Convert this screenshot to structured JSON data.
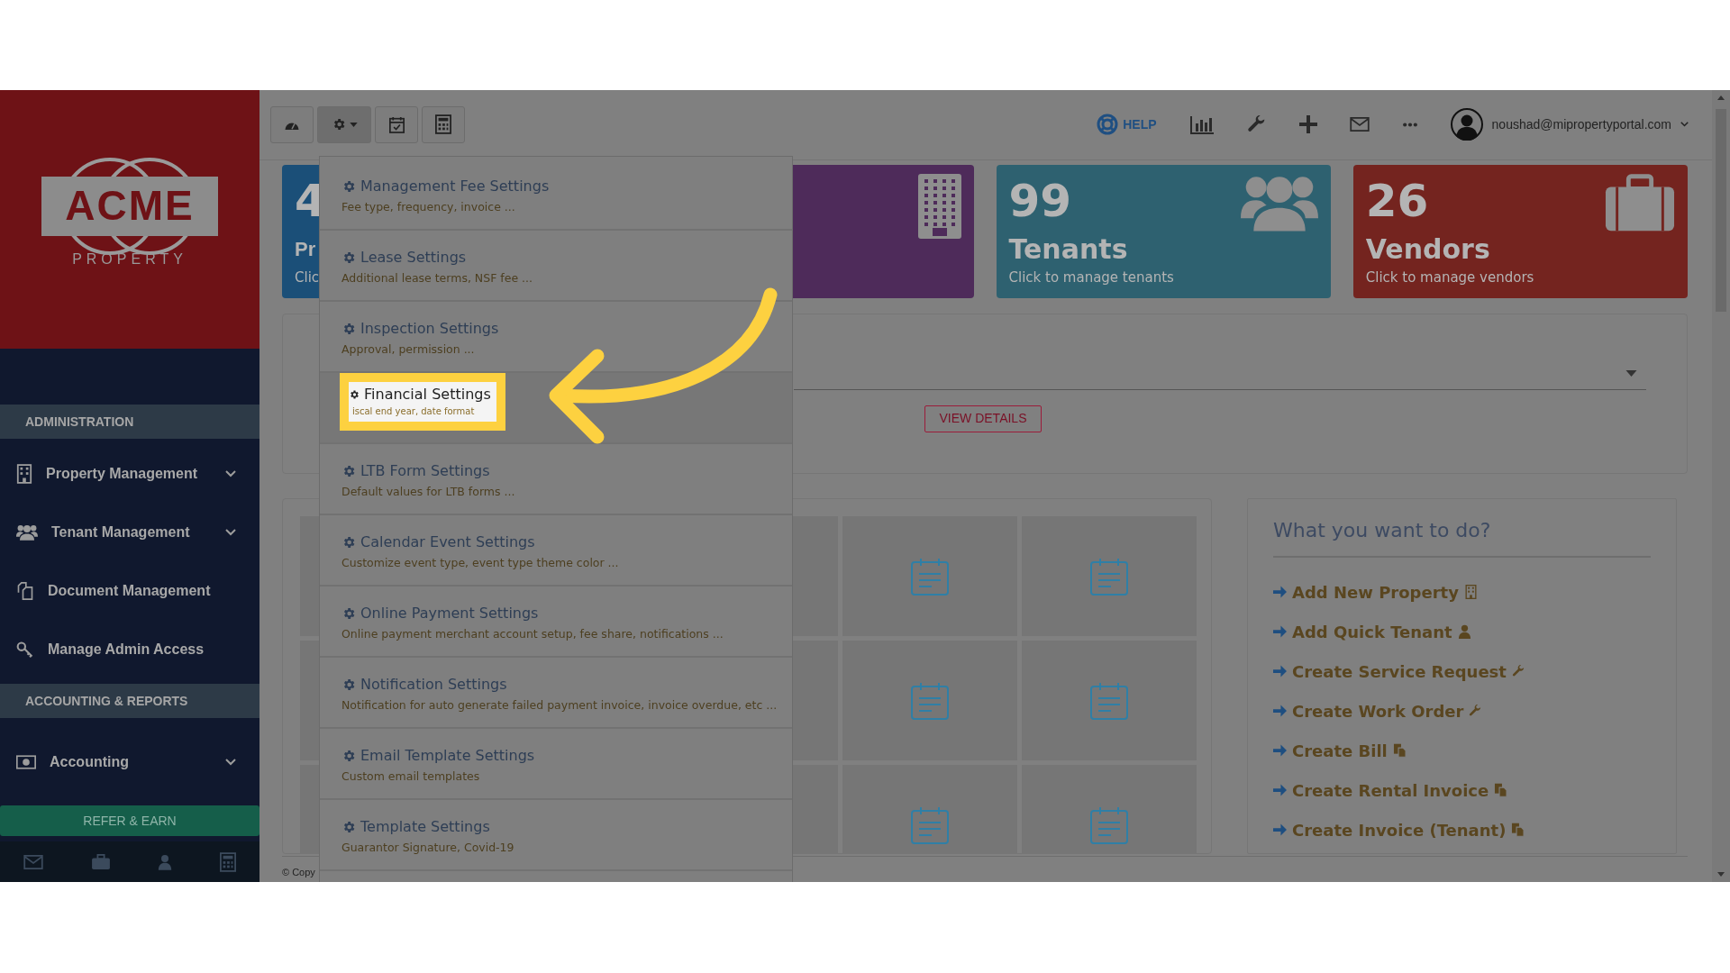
{
  "sidebar": {
    "logo": {
      "word": "ACME",
      "tagline": "PROPERTY"
    },
    "sections": [
      {
        "heading": "ADMINISTRATION",
        "items": [
          {
            "label": "Property Management",
            "expandable": true
          },
          {
            "label": "Tenant Management",
            "expandable": true
          },
          {
            "label": "Document Management",
            "expandable": false
          },
          {
            "label": "Manage Admin Access",
            "expandable": false
          }
        ]
      },
      {
        "heading": "ACCOUNTING & REPORTS",
        "items": [
          {
            "label": "Accounting",
            "expandable": true
          }
        ]
      }
    ],
    "refer_button": "REFER & EARN"
  },
  "toolbar": [
    {
      "selected": false
    },
    {
      "selected": true
    },
    {
      "selected": false
    },
    {
      "selected": false
    }
  ],
  "topbar": {
    "help_label": "HELP",
    "user_email": "noushad@mipropertyportal.com"
  },
  "cards": [
    {
      "number": "4",
      "label": "Pr",
      "subtitle": "Clic",
      "color": "#1b4f78"
    },
    {
      "color": "#4e2b5a"
    },
    {
      "number": "99",
      "label": "Tenants",
      "subtitle": "Click to manage tenants",
      "color": "#2e6170"
    },
    {
      "number": "26",
      "label": "Vendors",
      "subtitle": "Click to manage vendors",
      "color": "#74241f"
    }
  ],
  "view_details": "VIEW DETAILS",
  "quick_actions": {
    "title": "What you want to do?",
    "actions": [
      {
        "label": "Add New Property"
      },
      {
        "label": "Add Quick Tenant"
      },
      {
        "label": "Create Service Request"
      },
      {
        "label": "Create Work Order"
      },
      {
        "label": "Create Bill"
      },
      {
        "label": "Create Rental Invoice"
      },
      {
        "label": "Create Invoice (Tenant)"
      }
    ]
  },
  "copyright": "© Copy",
  "settings_menu": [
    {
      "title": "Management Fee Settings",
      "subtitle": "Fee type, frequency, invoice ...",
      "highlighted": false
    },
    {
      "title": "Lease Settings",
      "subtitle": "Additional lease terms, NSF fee ...",
      "highlighted": false
    },
    {
      "title": "Inspection Settings",
      "subtitle": "Approval, permission ...",
      "highlighted": false
    },
    {
      "title": "Financial Settings",
      "subtitle": "iscal end year, date format",
      "highlighted": true
    },
    {
      "title": "LTB Form Settings",
      "subtitle": "Default values for LTB forms ...",
      "highlighted": false
    },
    {
      "title": "Calendar Event Settings",
      "subtitle": "Customize event type, event type theme color ...",
      "highlighted": false
    },
    {
      "title": "Online Payment Settings",
      "subtitle": "Online payment merchant account setup, fee share, notifications ...",
      "highlighted": false
    },
    {
      "title": "Notification Settings",
      "subtitle": "Notification for auto generate failed payment invoice, invoice overdue, etc ...",
      "highlighted": false
    },
    {
      "title": "Email Template Settings",
      "subtitle": "Custom email templates",
      "highlighted": false
    },
    {
      "title": "Template Settings",
      "subtitle": "Guarantor Signature, Covid-19",
      "highlighted": false
    }
  ]
}
